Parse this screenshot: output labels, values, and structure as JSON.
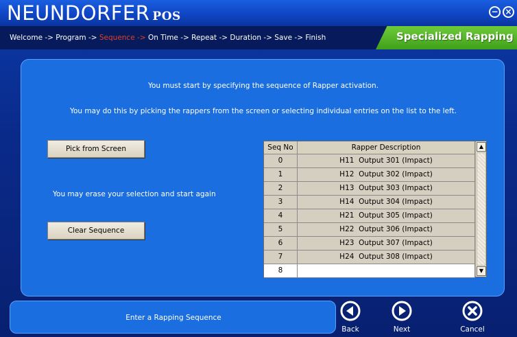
{
  "app": {
    "brand": "NEUNDORFER",
    "brand_sub": "POS",
    "min_symbol": "−",
    "close_symbol": "×"
  },
  "breadcrumb": [
    {
      "label": "Welcome",
      "state": "done"
    },
    {
      "label": "Program",
      "state": "done"
    },
    {
      "label": "Sequence",
      "state": "active"
    },
    {
      "label": "On Time",
      "state": "pending"
    },
    {
      "label": "Repeat",
      "state": "pending"
    },
    {
      "label": "Duration",
      "state": "pending"
    },
    {
      "label": "Save",
      "state": "pending"
    },
    {
      "label": "Finish",
      "state": "pending"
    }
  ],
  "breadcrumb_sep": " -> ",
  "section_title": "Specialized Rapping",
  "main": {
    "instruction1": "You must start by specifying the sequence of Rapper activation.",
    "instruction2": "You may do this by picking the rappers from the screen or selecting individual entries on the list to the left.",
    "pick_button": "Pick from Screen",
    "erase_text": "You may erase your selection and start again",
    "clear_button": "Clear Sequence"
  },
  "table": {
    "headers": [
      "Seq No",
      "Rapper Description"
    ],
    "rows": [
      {
        "seq": "0",
        "desc": "H11  Output 301 (Impact)"
      },
      {
        "seq": "1",
        "desc": "H12  Output 302 (Impact)"
      },
      {
        "seq": "2",
        "desc": "H13  Output 303 (Impact)"
      },
      {
        "seq": "3",
        "desc": "H14  Output 304 (Impact)"
      },
      {
        "seq": "4",
        "desc": "H21  Output 305 (Impact)"
      },
      {
        "seq": "5",
        "desc": "H22  Output 306 (Impact)"
      },
      {
        "seq": "6",
        "desc": "H23  Output 307 (Impact)"
      },
      {
        "seq": "7",
        "desc": "H24  Output 308 (Impact)"
      },
      {
        "seq": "8",
        "desc": ""
      }
    ],
    "scroll_up": "▲",
    "scroll_down": "▼"
  },
  "status": {
    "text": "Enter a Rapping Sequence"
  },
  "nav": {
    "back": "Back",
    "next": "Next",
    "cancel": "Cancel"
  },
  "colors": {
    "active_step": "#e0402a",
    "section_tab": "#4fb028",
    "panel": "#1a6ee0"
  }
}
